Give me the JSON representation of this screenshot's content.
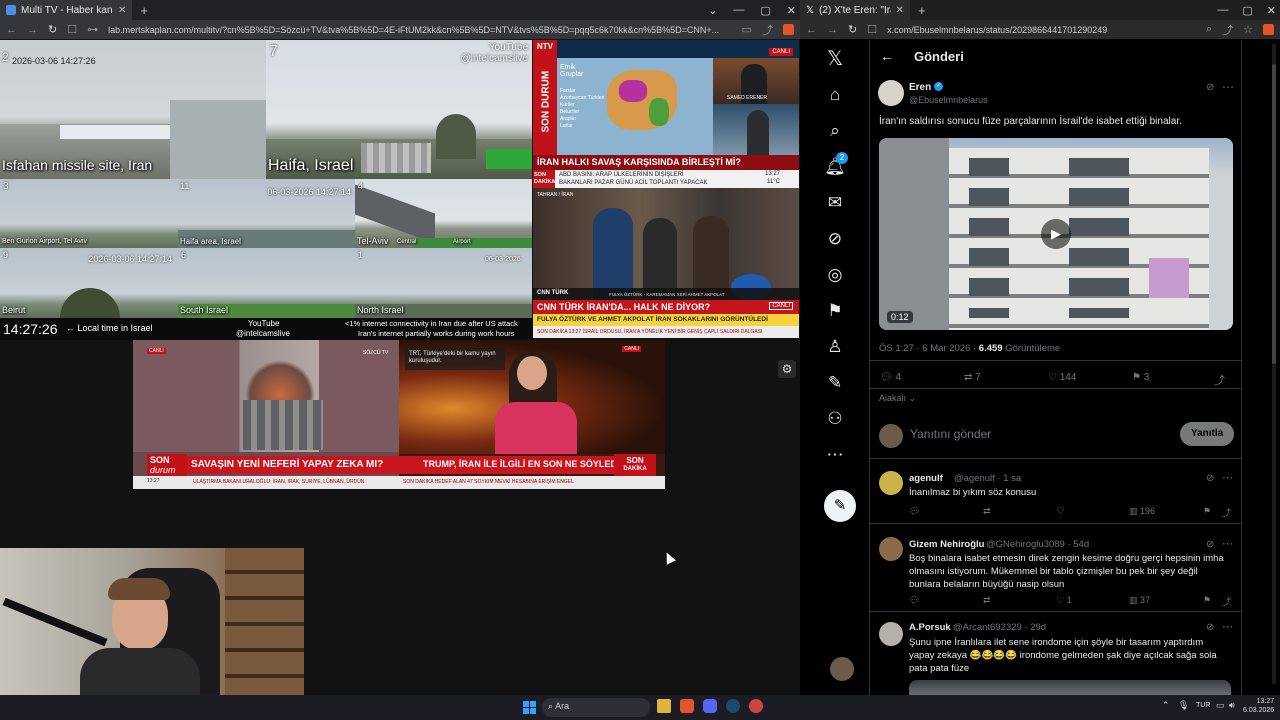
{
  "left_browser": {
    "tab_title": "Multi TV - Haber kanallarını aynı",
    "url": "lab.mertskaplan.com/multitv/?cn%5B%5D=Sözcü+TV&tva%5B%5D=4E-iFtUM2kk&cn%5B%5D=NTV&tvs%5B%5D=pqq5c6k70kk&cn%5B%5D=CNN+...",
    "cams": {
      "isfahan_label": "Isfahan missile site, Iran",
      "haifa_label": "Haifa, Israel",
      "cam7": "7",
      "cam3": "3",
      "cam11": "11",
      "cam4": "4",
      "cam9": "9",
      "cam6": "6",
      "cam1": "1",
      "cam2": "2",
      "youtube_top": "YouTube",
      "youtube_handle_top": "@intelcamslive",
      "ts_top": "2026-03-06 14:27:26",
      "ts_mid": "06-03-2026 14:27:14",
      "ts_small1": "2026-03-06 14:27:14",
      "ts_small2": "06-03-2026",
      "lbl_bengurion": "Ben Gurion Airport, Tel Aviv",
      "lbl_haifaarea": "Haifa area, Israel",
      "lbl_telaviv": "Tel-Aviv",
      "lbl_central": "Central",
      "lbl_airport": "Airport",
      "lbl_beirut": "Beirut",
      "lbl_south": "South Israel",
      "lbl_north": "North Israel",
      "local_time": "14:27:26",
      "local_time_label": "←  Local time in Israel",
      "youtube_bottom": "YouTube",
      "youtube_handle_bottom": "@intelcamslive",
      "internet_note_1": "<1% internet connectivity in Iran due after US attack",
      "internet_note_2": "Iran's internet partially works during work hours"
    },
    "ntv": {
      "logo": "NTV",
      "side": "SON DURUM",
      "legend_title": "Etnik Gruplar",
      "legend_items": [
        "Farslar",
        "Azerbaycan Türkleri",
        "Kürtler",
        "Beluciler",
        "Araplar",
        "Lurlar"
      ],
      "badge": "CANLI",
      "anchor": "SAMED ERENER",
      "headline": "İRAN HALKI SAVAŞ KARŞISINDA BİRLEŞTİ Mİ?",
      "son": "SON",
      "dakika": "DAKİKA",
      "ticker_1": "ABD BASINI: ARAP ÜLKELERİNİN DIŞİŞLERİ",
      "ticker_2": "BAKANLARI PAZAR GÜNÜ ACİL TOPLANTI YAPACAK",
      "time": "13:27",
      "temp": "11°C"
    },
    "cnn": {
      "place": "TAHRAN / İRAN",
      "brand": "CNN TÜRK",
      "reporter": "FULYA ÖZTÜRK - KAREMAMAN SEFİ AHMET AKPOLAT",
      "headline": "CNN TÜRK İRAN'DA... HALK NE DİYOR?",
      "sub": "FULYA ÖZTÜRK VE AHMET AKPOLAT İRAN SOKAKLARINI GÖRÜNTÜLEDİ",
      "ticker": "SON DAKİKA  13:27  İSRAİL ORDUSU, İRAN'A YÖNELİK YENİ BİR GENİŞ ÇAPLI SALDIRI DALGASI",
      "live": "CANLI"
    },
    "sozcu": {
      "badge": "CANLI",
      "small_tag": "SÖZCÜ TV",
      "son": "SON",
      "durum": "durum",
      "headline": "SAVAŞIN YENİ NEFERİ YAPAY ZEKA MI?",
      "ticker": "ULAŞTIRMA BAKANI URALOĞLU: İRAN, IRAK, SURİYE, LÜBNAN, ÜRDÜN",
      "time": "13:27"
    },
    "trt": {
      "notice": "TRT, Türkiye'deki bir kamu yayın kuruluşudur.",
      "headline": "TRUMP, İRAN İLE İLGİLİ EN SON NE SÖYLEDİ?",
      "son": "SON",
      "dakika": "DAKİKA",
      "badge": "CANLI",
      "ticker": "SON DAKİKA  HEDEF ALAN 47 SOYKIM MEVKİ HESABINA ERİŞİM ENGEL"
    }
  },
  "right_browser": {
    "tab_title": "(2) X'te Eren: \"İran'ın saldırısı so...",
    "url": "x.com/Ebuselmnbelarus/status/2029866441701290249",
    "header": "Gönderi",
    "author_name": "Eren",
    "author_handle": "@Ebuselmnbelarus",
    "post_text": "İran'ın saldırısı sonucu füze parçalarının İsrail'de isabet ettiği binalar.",
    "video_duration": "0:12",
    "timestamp": "ÖS 1:27 · 6 Mar 2026 · ",
    "views_count": "6.459",
    "views_label": " Görüntüleme",
    "replies": "4",
    "reposts": "7",
    "likes": "144",
    "bookmarks": "3",
    "relevance": "Alakalı",
    "reply_placeholder": "Yanıtını gönder",
    "reply_button": "Yanıtla",
    "notif_badge": "2",
    "comments": [
      {
        "name": "agenulf",
        "handle": "@agenulf · 1 sa",
        "text": "İnanılmaz bi yıkım söz konusu",
        "views": "196",
        "likes": ""
      },
      {
        "name": "Gizem Nehiroğlu",
        "handle": "@GNehiroglu3089 · 54d",
        "text": "Boş binalara isabet etmesin direk zengin kesime doğru gerçi hepsinin imha olmasını istiyorum. Mükemmel bir tablo çizmişler bu pek bir şey değil bunlara belaların büyüğü nasip olsun",
        "views": "37",
        "likes": "1"
      },
      {
        "name": "A.Porsuk",
        "handle": "@Arcant692329 · 29d",
        "text": "Şunu ipne İranlılara ilet sene irondome için şöyle bir tasarım yaptırdım yapay zekaya 😂😂😂😂 irondome gelmeden şak diye açılcak sağa sola pata pata füze",
        "views": "",
        "likes": ""
      }
    ]
  },
  "taskbar": {
    "search": "Ara",
    "lang": "TUR",
    "time": "13:27",
    "date": "6.03.2026"
  }
}
